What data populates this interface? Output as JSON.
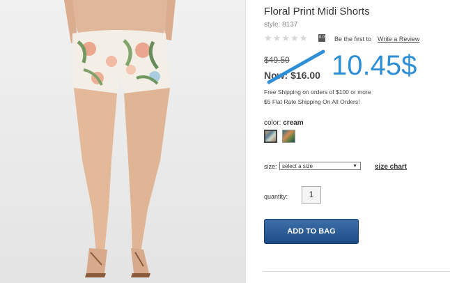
{
  "product": {
    "title": "Floral Print Midi Shorts",
    "style": "style: 8137",
    "rating_badge": "0.0",
    "review_prompt": "Be the first to",
    "review_link": "Write a Review",
    "was_price": "$49.50",
    "now_price": "Now: $16.00",
    "annotation_price": "10.45$",
    "shipping_line_1": "Free Shipping on orders of $100 or more",
    "shipping_line_2": "$5 Flat Rate Shipping On All Orders!",
    "color_label": "color:",
    "color_value": "cream",
    "size_label": "size:",
    "size_selected": "select a size",
    "size_chart": "size chart",
    "quantity_label": "quantity:",
    "quantity_value": "1",
    "add_to_bag": "ADD TO BAG"
  },
  "colors": {
    "annotation_blue": "#2f8fd6",
    "button_blue": "#1c4c86"
  },
  "icons": [
    "star-icon",
    "chevron-down-icon"
  ]
}
